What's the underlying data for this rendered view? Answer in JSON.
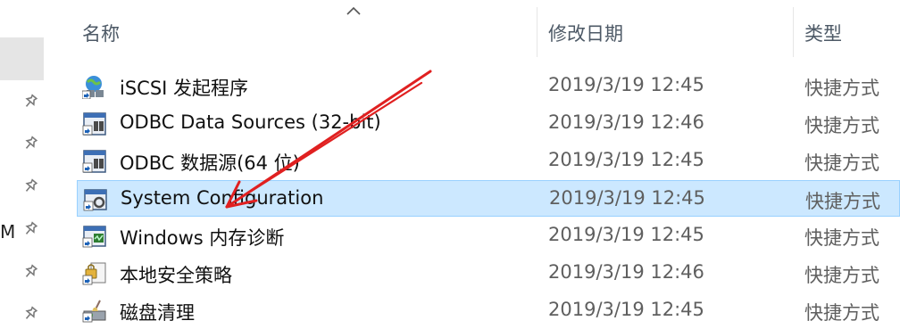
{
  "nav": {
    "clipped_text": "M"
  },
  "header": {
    "col_name": "名称",
    "col_modified": "修改日期",
    "col_type": "类型"
  },
  "files": [
    {
      "name": "iSCSI 发起程序",
      "date": "2019/3/19 12:45",
      "type": "快捷方式",
      "icon": "iscsi-shortcut-icon"
    },
    {
      "name": "ODBC Data Sources (32-bit)",
      "date": "2019/3/19 12:46",
      "type": "快捷方式",
      "icon": "odbc-shortcut-icon"
    },
    {
      "name": "ODBC 数据源(64 位)",
      "date": "2019/3/19 12:45",
      "type": "快捷方式",
      "icon": "odbc-shortcut-icon"
    },
    {
      "name": "System Configuration",
      "date": "2019/3/19 12:45",
      "type": "快捷方式",
      "icon": "msconfig-shortcut-icon",
      "selected": true
    },
    {
      "name": "Windows 内存诊断",
      "date": "2019/3/19 12:45",
      "type": "快捷方式",
      "icon": "memory-diagnostic-shortcut-icon"
    },
    {
      "name": "本地安全策略",
      "date": "2019/3/19 12:46",
      "type": "快捷方式",
      "icon": "security-policy-shortcut-icon"
    },
    {
      "name": "磁盘清理",
      "date": "2019/3/19 12:45",
      "type": "快捷方式",
      "icon": "disk-cleanup-shortcut-icon"
    }
  ],
  "colors": {
    "selection_bg": "#cce8ff",
    "selection_border": "#99d1ff",
    "annotation_arrow": "#e02020"
  }
}
